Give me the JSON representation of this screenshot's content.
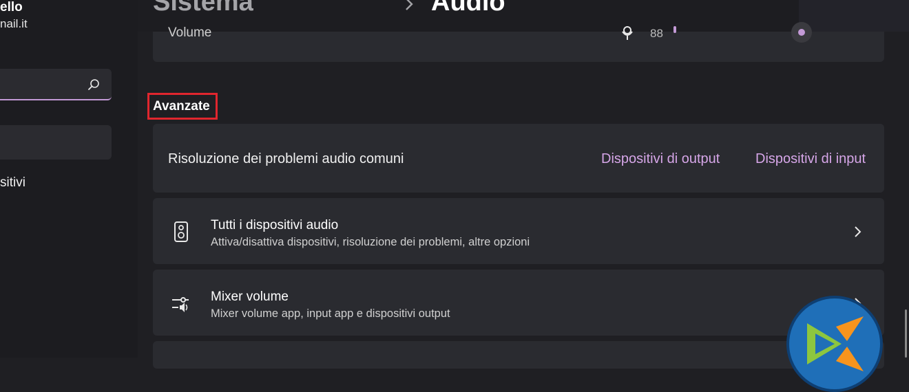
{
  "sidebar": {
    "user_name": "ello",
    "user_email": "nail.it",
    "nav_item_label": "sitivi"
  },
  "header": {
    "breadcrumb_parent": "Sistema",
    "breadcrumb_current": "Audio"
  },
  "volume_card": {
    "label": "Volume",
    "value": "88"
  },
  "advanced": {
    "section_title": "Avanzate",
    "troubleshoot": {
      "label": "Risoluzione dei problemi audio comuni",
      "output_link": "Dispositivi di output",
      "input_link": "Dispositivi di input"
    },
    "rows": [
      {
        "title": "Tutti i dispositivi audio",
        "subtitle": "Attiva/disattiva dispositivi, risoluzione dei problemi, altre opzioni",
        "icon": "speaker-icon"
      },
      {
        "title": "Mixer volume",
        "subtitle": "Mixer volume app, input app e dispositivi output",
        "icon": "mixer-icon"
      }
    ]
  },
  "colors": {
    "accent": "#c39ad6",
    "link": "#d6a6e8",
    "highlight_border": "#e0262e",
    "card": "#2a2b30",
    "background": "#1f1f23"
  }
}
